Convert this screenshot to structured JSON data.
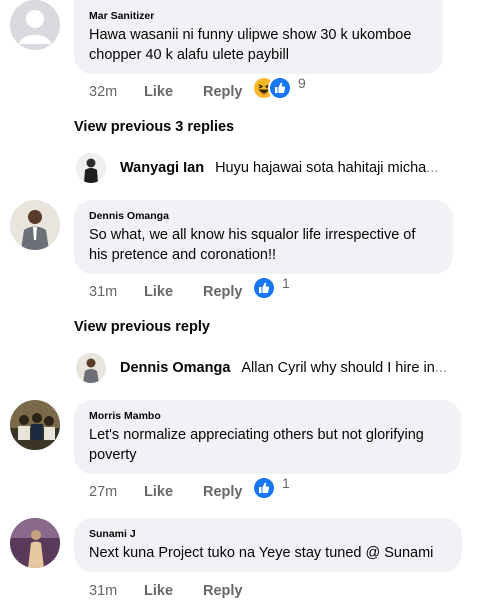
{
  "comments": [
    {
      "author": "Mar Sanitizer",
      "text_lines": [
        "Hawa wasanii ni funny ulipwe show 30 k ukomboe",
        "chopper 40 k alafu ulete paybill"
      ],
      "time": "32m",
      "like_label": "Like",
      "reply_label": "Reply",
      "reaction_count": "9",
      "reactions": [
        "haha-icon",
        "like-icon"
      ]
    },
    {
      "author": "Dennis Omanga",
      "text_lines": [
        "So what, we all know his squalor life irrespective of",
        "his pretence and coronation!!"
      ],
      "time": "31m",
      "like_label": "Like",
      "reply_label": "Reply",
      "reaction_count": "1",
      "reactions": [
        "like-icon"
      ]
    },
    {
      "author": "Morris Mambo",
      "text_lines": [
        "Let's normalize appreciating others but not glorifying",
        "poverty"
      ],
      "time": "27m",
      "like_label": "Like",
      "reply_label": "Reply",
      "reaction_count": "1",
      "reactions": [
        "like-icon"
      ]
    },
    {
      "author": "Sunami J",
      "text_lines": [
        "Next kuna Project tuko na Yeye stay tuned @ Sunami"
      ],
      "time": "31m",
      "like_label": "Like",
      "reply_label": "Reply"
    }
  ],
  "view_previous": [
    {
      "label": "View previous 3 replies"
    },
    {
      "label": "View previous reply"
    }
  ],
  "reply_previews": [
    {
      "name": "Wanyagi Ian",
      "text": "Huyu hajawai sota hahitaji micha",
      "ellipsis": "..."
    },
    {
      "name": "Dennis Omanga",
      "text": "Allan Cyril why should I hire in",
      "ellipsis": "..."
    }
  ],
  "colors": {
    "bubble": "#f0f2f5",
    "meta_text": "#65676b",
    "like_blue": "#1877f2",
    "haha_yellow": "#f7b928"
  }
}
